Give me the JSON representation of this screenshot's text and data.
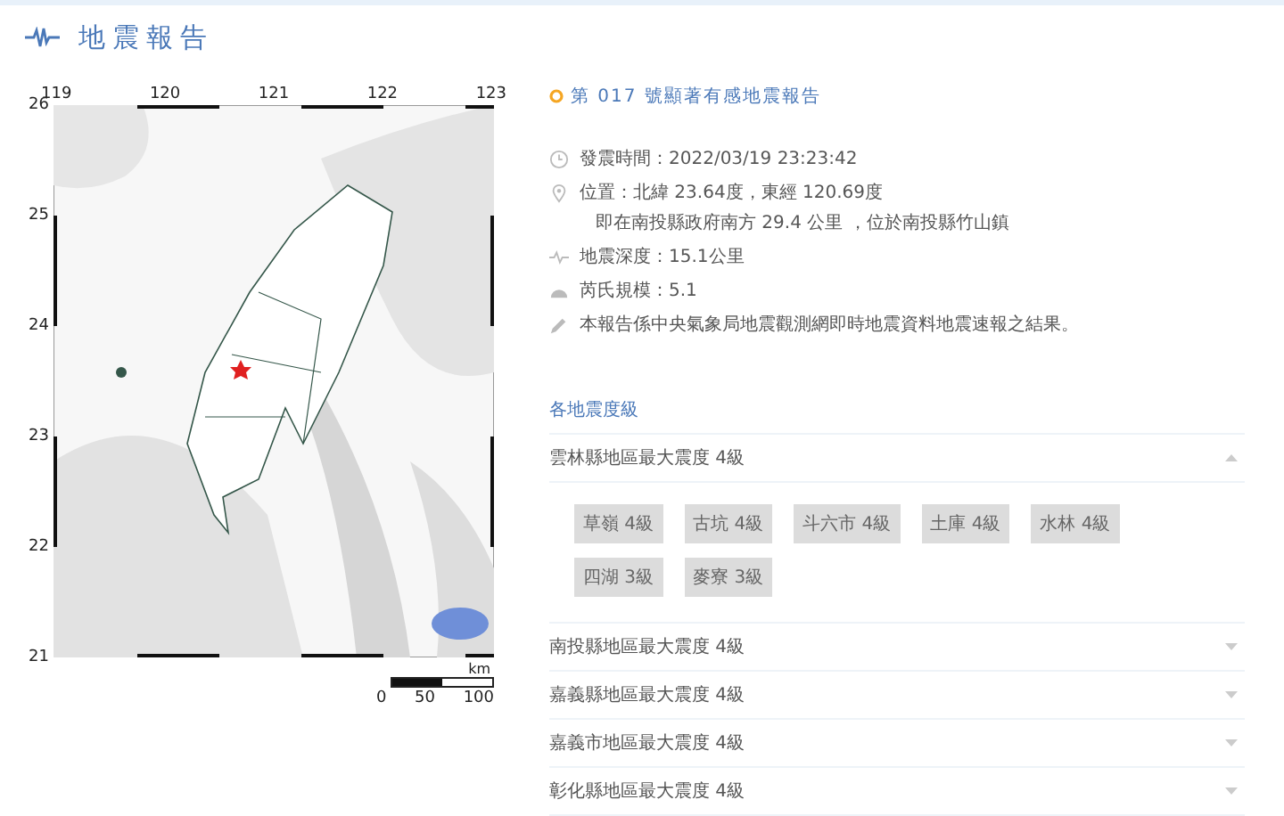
{
  "header": {
    "title": "地震報告"
  },
  "map": {
    "lon_ticks": [
      "119",
      "120",
      "121",
      "122",
      "123"
    ],
    "lat_ticks": [
      "26",
      "25",
      "24",
      "23",
      "22",
      "21"
    ],
    "scale": {
      "unit": "km",
      "labels": [
        "0",
        "50",
        "100"
      ]
    }
  },
  "report": {
    "title": "第 017 號顯著有感地震報告",
    "info": [
      {
        "kind": "time",
        "text": "發震時間：2022/03/19 23:23:42"
      },
      {
        "kind": "location",
        "text": "位置：北緯 23.64度，東經 120.69度",
        "subtext": "即在南投縣政府南方 29.4 公里 ，位於南投縣竹山鎮"
      },
      {
        "kind": "depth",
        "text": "地震深度：15.1公里"
      },
      {
        "kind": "magnitude",
        "text": "芮氏規模：5.1"
      },
      {
        "kind": "note",
        "text": "本報告係中央氣象局地震觀測網即時地震資料地震速報之結果。"
      }
    ]
  },
  "intensity": {
    "title": "各地震度級",
    "regions": [
      {
        "title": "雲林縣地區最大震度 4級",
        "expanded": true,
        "stations": [
          "草嶺 4級",
          "古坑 4級",
          "斗六市 4級",
          "土庫 4級",
          "水林 4級",
          "四湖 3級",
          "麥寮 3級"
        ]
      },
      {
        "title": "南投縣地區最大震度 4級",
        "expanded": false
      },
      {
        "title": "嘉義縣地區最大震度 4級",
        "expanded": false
      },
      {
        "title": "嘉義市地區最大震度 4級",
        "expanded": false
      },
      {
        "title": "彰化縣地區最大震度 4級",
        "expanded": false
      }
    ]
  }
}
